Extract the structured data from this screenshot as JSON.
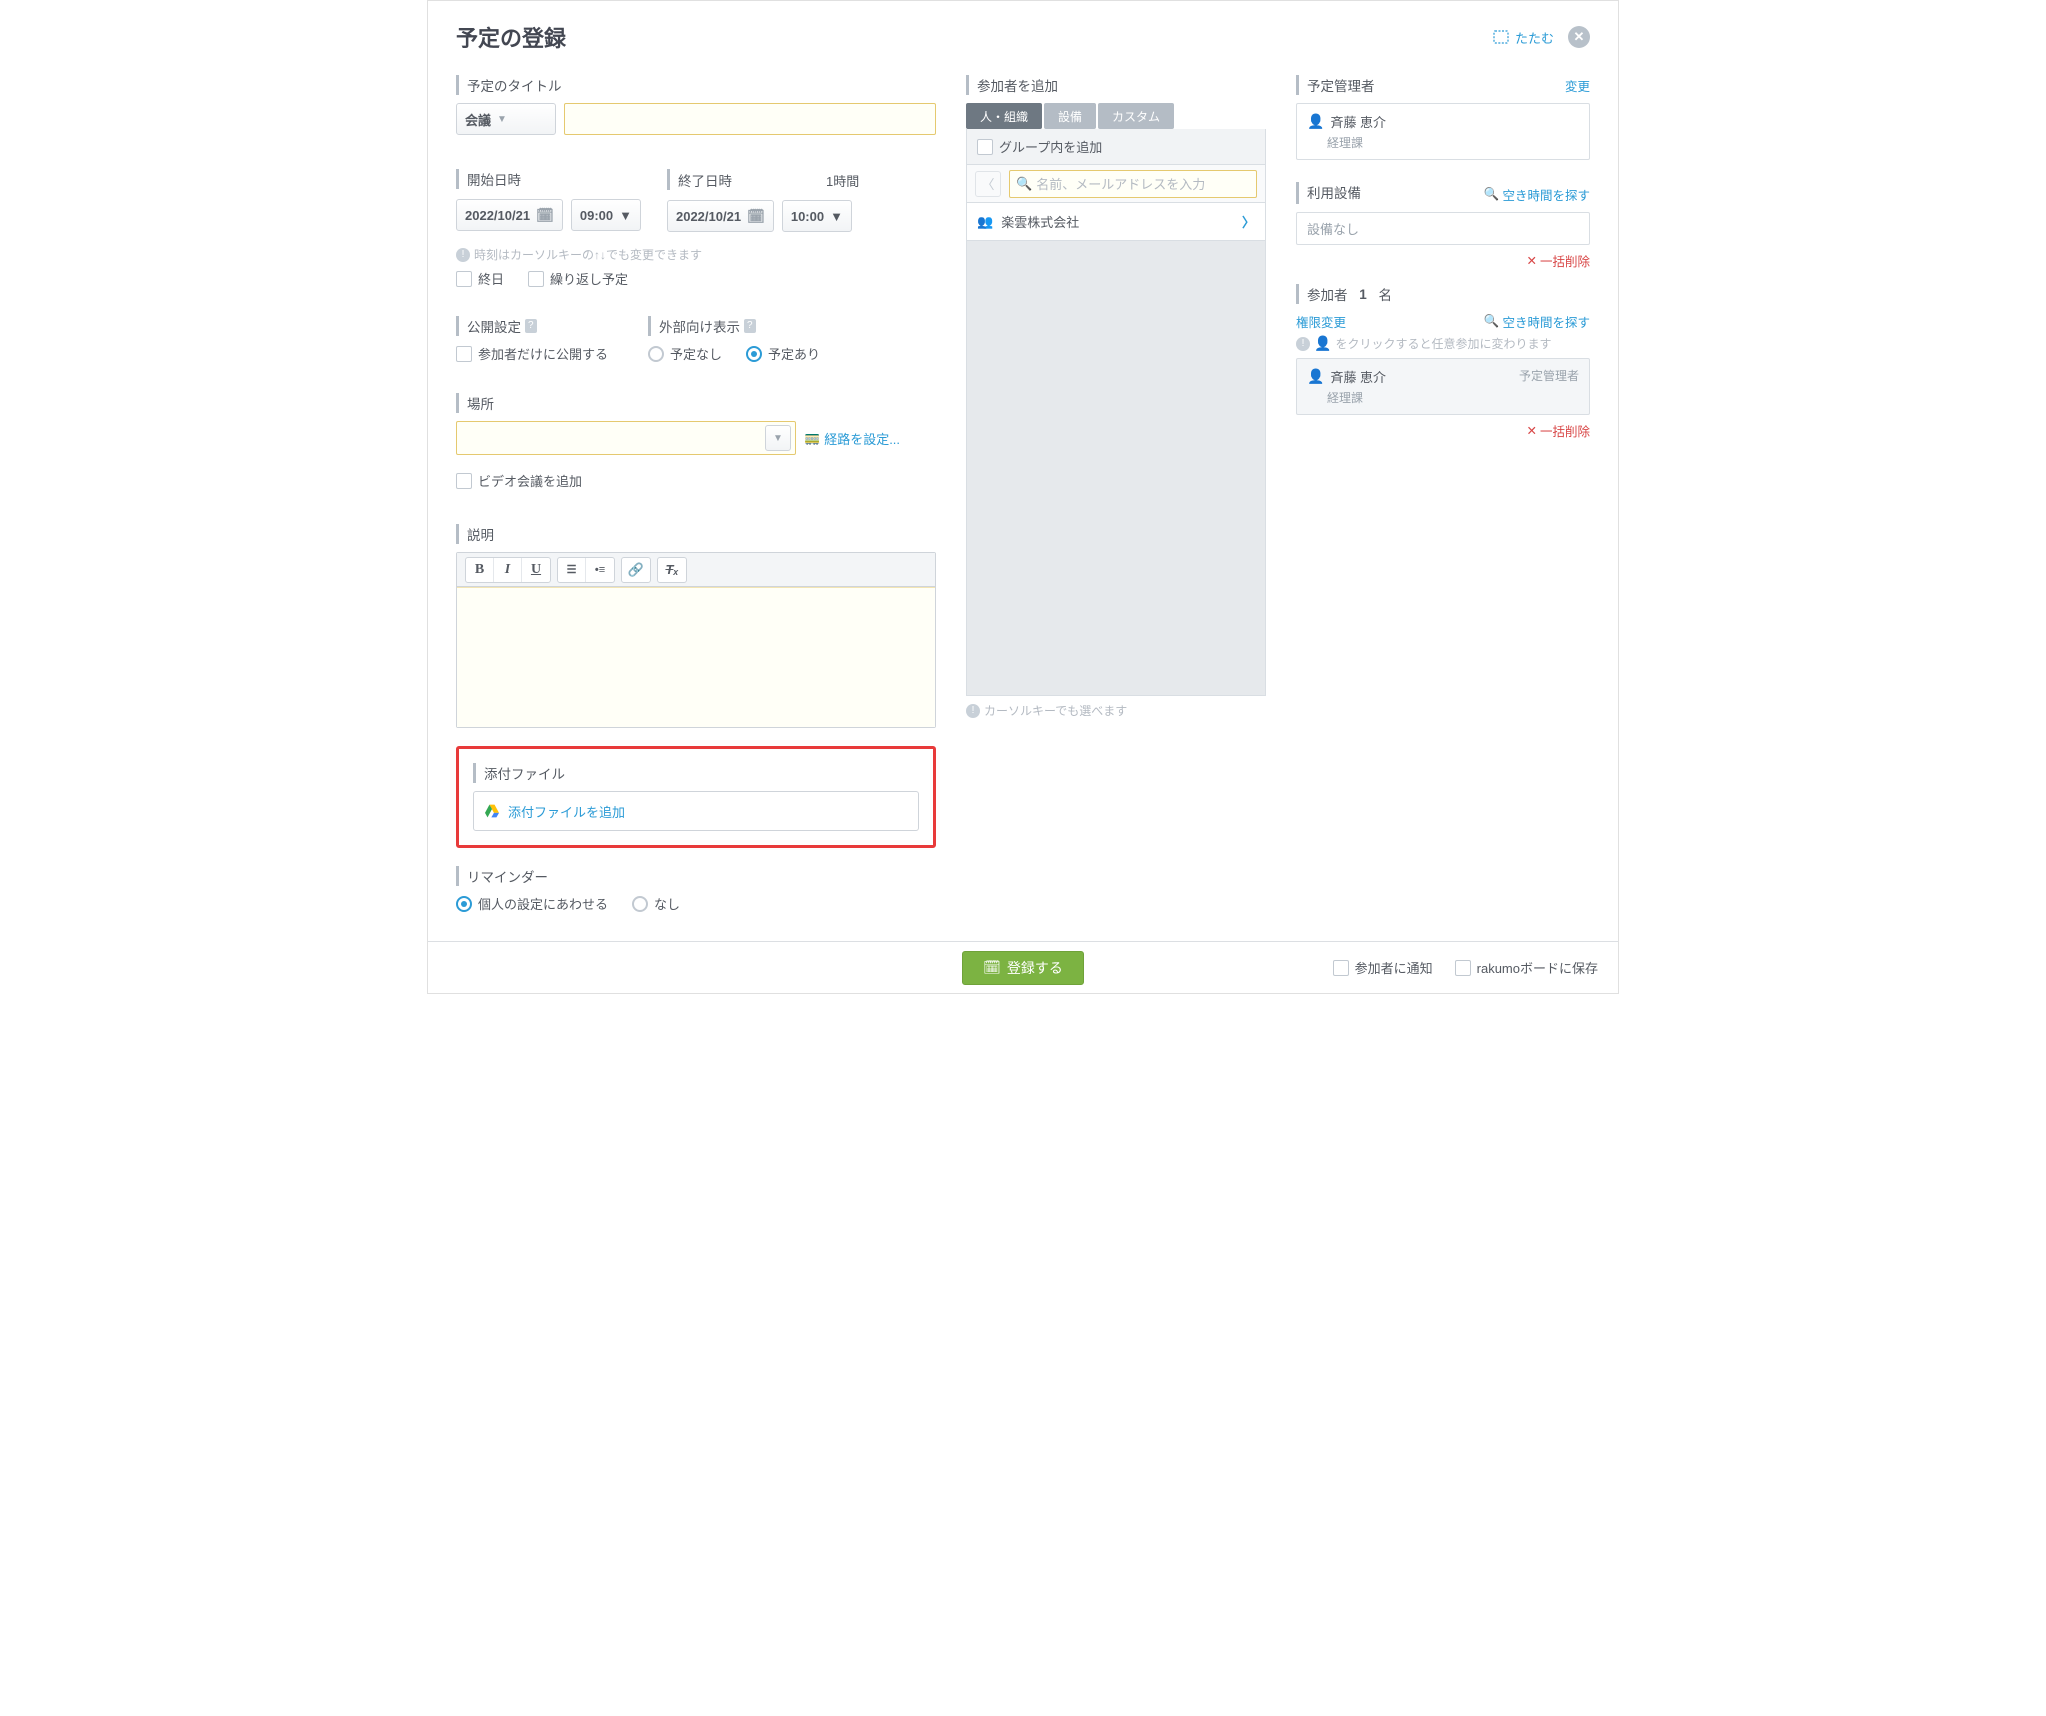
{
  "header": {
    "title": "予定の登録",
    "collapse": "たたむ"
  },
  "title_section": {
    "label": "予定のタイトル",
    "type_select": "会議"
  },
  "datetime": {
    "start_label": "開始日時",
    "end_label": "終了日時",
    "start_date": "2022/10/21",
    "start_time": "09:00",
    "end_date": "2022/10/21",
    "end_time": "10:00",
    "duration": "1時間",
    "hint": "時刻はカーソルキーの↑↓でも変更できます",
    "allday": "終日",
    "repeat": "繰り返し予定"
  },
  "visibility": {
    "label": "公開設定",
    "participants_only": "参加者だけに公開する",
    "external_label": "外部向け表示",
    "none": "予定なし",
    "has": "予定あり"
  },
  "location": {
    "label": "場所",
    "route": "経路を設定...",
    "video": "ビデオ会議を追加"
  },
  "description": {
    "label": "説明"
  },
  "attachment": {
    "label": "添付ファイル",
    "add": "添付ファイルを追加"
  },
  "reminder": {
    "label": "リマインダー",
    "personal": "個人の設定にあわせる",
    "none": "なし"
  },
  "participants": {
    "add_label": "参加者を追加",
    "tabs": {
      "people": "人・組織",
      "equipment": "設備",
      "custom": "カスタム"
    },
    "group_add": "グループ内を追加",
    "search_placeholder": "名前、メールアドレスを入力",
    "org": "楽雲株式会社",
    "hint": "カーソルキーでも選べます"
  },
  "right": {
    "manager_label": "予定管理者",
    "change": "変更",
    "manager_name": "斉藤 恵介",
    "manager_dept": "経理課",
    "equipment_label": "利用設備",
    "find_free": "空き時間を探す",
    "no_equipment": "設備なし",
    "delete_all": "一括削除",
    "participants_label_pre": "参加者",
    "participants_count": "1",
    "participants_unit": "名",
    "permission": "権限変更",
    "info": "をクリックすると任意参加に変わります",
    "role": "予定管理者"
  },
  "footer": {
    "submit": "登録する",
    "notify": "参加者に通知",
    "save_board": "rakumoボードに保存"
  }
}
